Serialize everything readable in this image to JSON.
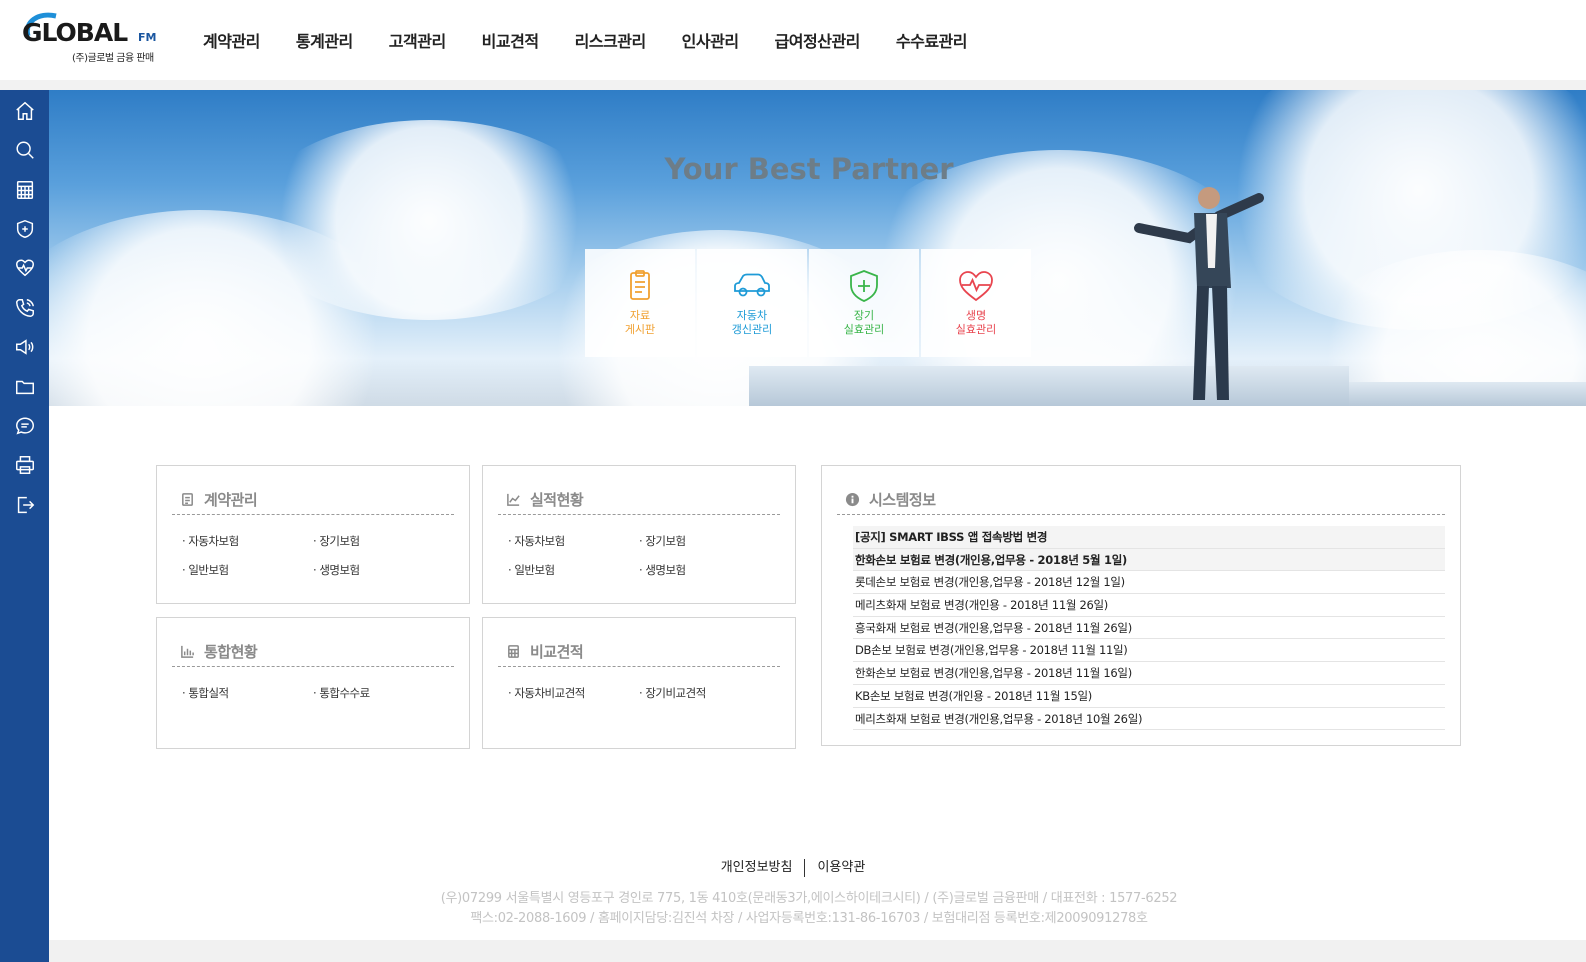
{
  "brand": {
    "logo_text": "GLOBAL",
    "logo_suffix": "FM",
    "logo_sub": "(주)글로벌 금융 판매"
  },
  "nav": [
    "계약관리",
    "통계관리",
    "고객관리",
    "비교견적",
    "리스크관리",
    "인사관리",
    "급여정산관리",
    "수수료관리"
  ],
  "sidebar": [
    "home-icon",
    "search-icon",
    "calculator-icon",
    "shield-icon",
    "heartbeat-icon",
    "phone-icon",
    "megaphone-icon",
    "folder-icon",
    "chat-icon",
    "printer-icon",
    "logout-icon"
  ],
  "hero": {
    "title": "Your Best Partner",
    "quick": [
      {
        "label": "자료\n게시판",
        "color": "#f0a030",
        "icon": "clipboard-icon"
      },
      {
        "label": "자동차\n갱신관리",
        "color": "#1e9bd7",
        "icon": "car-icon"
      },
      {
        "label": "장기\n실효관리",
        "color": "#3ab54a",
        "icon": "shield-plus-icon"
      },
      {
        "label": "생명\n실효관리",
        "color": "#e8454f",
        "icon": "heart-pulse-icon"
      }
    ]
  },
  "panels": {
    "contract": {
      "title": "계약관리",
      "links": [
        "자동차보험",
        "장기보험",
        "일반보험",
        "생명보험"
      ]
    },
    "performance": {
      "title": "실적현황",
      "links": [
        "자동차보험",
        "장기보험",
        "일반보험",
        "생명보험"
      ]
    },
    "integrated": {
      "title": "통합현황",
      "links": [
        "통합실적",
        "통합수수료"
      ]
    },
    "compare": {
      "title": "비교견적",
      "links": [
        "자동차비교견적",
        "장기비교견적"
      ]
    },
    "system": {
      "title": "시스템정보",
      "rows": [
        "[공지] SMART IBSS 앱 접속방법 변경",
        "한화손보 보험료 변경(개인용,업무용 - 2018년 5월 1일)",
        "롯데손보 보험료 변경(개인용,업무용 - 2018년 12월 1일)",
        "메리츠화재 보험료 변경(개인용 - 2018년 11월 26일)",
        "흥국화재 보험료 변경(개인용,업무용 - 2018년 11월 26일)",
        "DB손보 보험료 변경(개인용,업무용 - 2018년 11월 11일)",
        "한화손보 보험료 변경(개인용,업무용 - 2018년 11월 16일)",
        "KB손보 보험료 변경(개인용 - 2018년 11월 15일)",
        "메리츠화재 보험료 변경(개인용,업무용 - 2018년 10월 26일)"
      ]
    }
  },
  "footer": {
    "privacy": "개인정보방침",
    "terms": "이용약관",
    "address1": "(우)07299 서울특별시 영등포구 경인로 775, 1동 410호(문래동3가,에이스하이테크시티) / (주)글로벌 금융판매 / 대표전화 : 1577-6252",
    "address2": "팩스:02-2088-1609 / 홈페이지담당:김진석 차장 / 사업자등록번호:131-86-16703 / 보험대리점 등록번호:제2009091278호"
  }
}
